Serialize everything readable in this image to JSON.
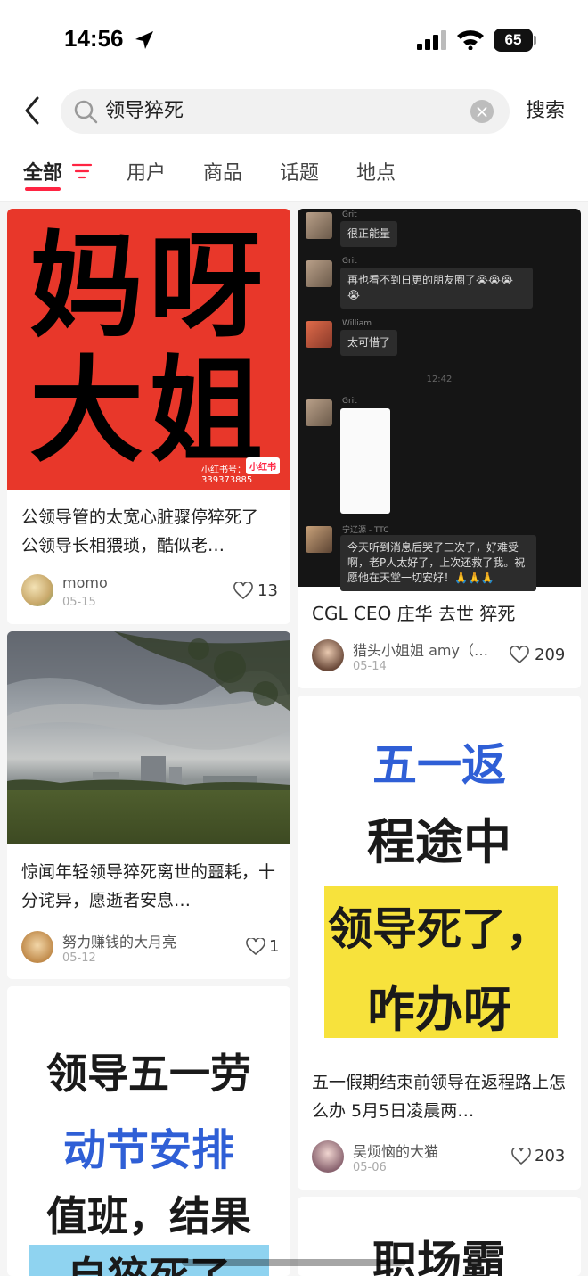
{
  "status": {
    "time": "14:56",
    "battery": "65"
  },
  "search": {
    "query": "领导猝死",
    "submit_label": "搜索"
  },
  "tabs": [
    {
      "label": "全部"
    },
    {
      "label": "用户"
    },
    {
      "label": "商品"
    },
    {
      "label": "话题"
    },
    {
      "label": "地点"
    }
  ],
  "cards": [
    {
      "poster_lines": [
        "妈呀",
        "大姐"
      ],
      "watermark_logo": "小红书",
      "watermark_id": "小红书号：339373885",
      "title": "公领导管的太宽心脏骤停猝死了 公领导长相猥琐，酷似老…",
      "author": "momo",
      "date": "05-15",
      "likes": "13"
    },
    {
      "chat": [
        {
          "name": "Grit",
          "text": "很正能量"
        },
        {
          "name": "Grit",
          "text": "再也看不到日更的朋友圈了😭😭😭😭"
        },
        {
          "name": "William",
          "text": "太可惜了"
        },
        {
          "time": "12:42"
        },
        {
          "name": "Grit",
          "text": ""
        },
        {
          "name": "宁辽源 - TTC",
          "text": "今天听到消息后哭了三次了，好难受啊，老P人太好了，上次还救了我。祝愿他在天堂一切安好！🙏🙏🙏"
        }
      ],
      "title": "CGL CEO 庄华 去世 猝死",
      "author": "猎头小姐姐 amy（…",
      "date": "05-14",
      "likes": "209"
    },
    {
      "title": "惊闻年轻领导猝死离世的噩耗，十分诧异，愿逝者安息…",
      "author": "努力赚钱的大月亮",
      "date": "05-12",
      "likes": "1"
    },
    {
      "poster_lines": [
        "五一返",
        "程途中",
        "领导死了，",
        "咋办呀"
      ],
      "title": "五一假期结束前领导在返程路上怎么办 5月5日凌晨两…",
      "author": "吴烦恼的大猫",
      "date": "05-06",
      "likes": "203"
    },
    {
      "poster_lines": [
        "领导五一劳",
        "动节安排",
        "值班，结果",
        "自猝死了"
      ]
    },
    {
      "poster_lines": [
        "职场霸"
      ]
    }
  ],
  "colors": {
    "accent": "#ff2442",
    "poster_red": "#e8372a",
    "highlight_yellow": "#f7e23c",
    "hw_blue": "#2f5fd6"
  }
}
